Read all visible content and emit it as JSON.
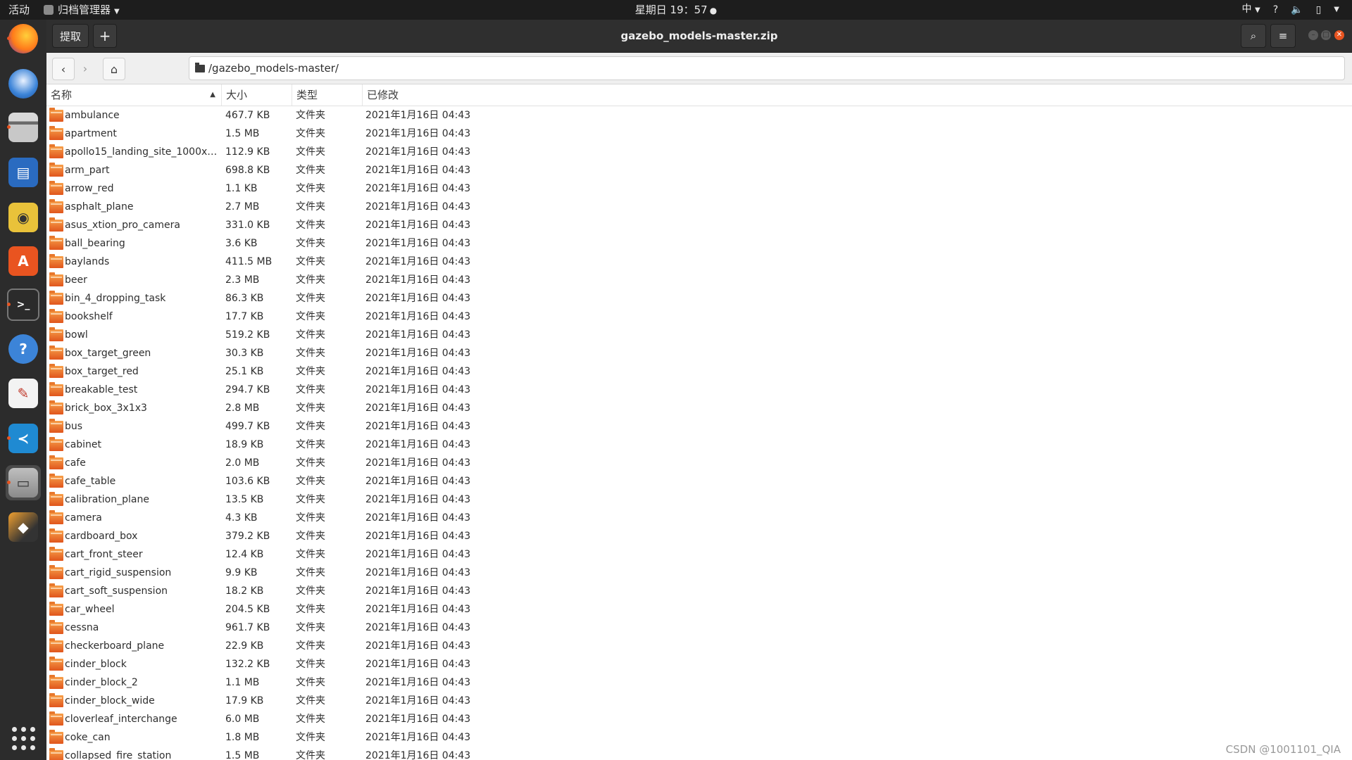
{
  "topbar": {
    "activities": "活动",
    "app_menu": "归档管理器",
    "clock": "星期日 19：57",
    "tray": {
      "input_method": "中",
      "help": "?",
      "volume_icon": "volume-icon",
      "power_icon": "battery-icon"
    }
  },
  "dock": {
    "items": [
      "firefox-icon",
      "thunderbird-icon",
      "files-icon",
      "writer-icon",
      "rhythmbox-icon",
      "software-icon",
      "terminal-icon",
      "help-icon",
      "text-editor-icon",
      "vscode-icon",
      "archive-manager-icon",
      "virtualbox-icon",
      "show-apps-icon"
    ]
  },
  "window": {
    "title": "gazebo_models-master.zip",
    "extract_label": "提取",
    "add_label": "+"
  },
  "location": {
    "path": "/gazebo_models-master/"
  },
  "columns": {
    "name": "名称",
    "size": "大小",
    "type": "类型",
    "modified": "已修改"
  },
  "files": [
    {
      "name": "ambulance",
      "size": "467.7 KB",
      "type": "文件夹",
      "modified": "2021年1月16日 04:43"
    },
    {
      "name": "apartment",
      "size": "1.5 MB",
      "type": "文件夹",
      "modified": "2021年1月16日 04:43"
    },
    {
      "name": "apollo15_landing_site_1000x1...",
      "size": "112.9 KB",
      "type": "文件夹",
      "modified": "2021年1月16日 04:43"
    },
    {
      "name": "arm_part",
      "size": "698.8 KB",
      "type": "文件夹",
      "modified": "2021年1月16日 04:43"
    },
    {
      "name": "arrow_red",
      "size": "1.1 KB",
      "type": "文件夹",
      "modified": "2021年1月16日 04:43"
    },
    {
      "name": "asphalt_plane",
      "size": "2.7 MB",
      "type": "文件夹",
      "modified": "2021年1月16日 04:43"
    },
    {
      "name": "asus_xtion_pro_camera",
      "size": "331.0 KB",
      "type": "文件夹",
      "modified": "2021年1月16日 04:43"
    },
    {
      "name": "ball_bearing",
      "size": "3.6 KB",
      "type": "文件夹",
      "modified": "2021年1月16日 04:43"
    },
    {
      "name": "baylands",
      "size": "411.5 MB",
      "type": "文件夹",
      "modified": "2021年1月16日 04:43"
    },
    {
      "name": "beer",
      "size": "2.3 MB",
      "type": "文件夹",
      "modified": "2021年1月16日 04:43"
    },
    {
      "name": "bin_4_dropping_task",
      "size": "86.3 KB",
      "type": "文件夹",
      "modified": "2021年1月16日 04:43"
    },
    {
      "name": "bookshelf",
      "size": "17.7 KB",
      "type": "文件夹",
      "modified": "2021年1月16日 04:43"
    },
    {
      "name": "bowl",
      "size": "519.2 KB",
      "type": "文件夹",
      "modified": "2021年1月16日 04:43"
    },
    {
      "name": "box_target_green",
      "size": "30.3 KB",
      "type": "文件夹",
      "modified": "2021年1月16日 04:43"
    },
    {
      "name": "box_target_red",
      "size": "25.1 KB",
      "type": "文件夹",
      "modified": "2021年1月16日 04:43"
    },
    {
      "name": "breakable_test",
      "size": "294.7 KB",
      "type": "文件夹",
      "modified": "2021年1月16日 04:43"
    },
    {
      "name": "brick_box_3x1x3",
      "size": "2.8 MB",
      "type": "文件夹",
      "modified": "2021年1月16日 04:43"
    },
    {
      "name": "bus",
      "size": "499.7 KB",
      "type": "文件夹",
      "modified": "2021年1月16日 04:43"
    },
    {
      "name": "cabinet",
      "size": "18.9 KB",
      "type": "文件夹",
      "modified": "2021年1月16日 04:43"
    },
    {
      "name": "cafe",
      "size": "2.0 MB",
      "type": "文件夹",
      "modified": "2021年1月16日 04:43"
    },
    {
      "name": "cafe_table",
      "size": "103.6 KB",
      "type": "文件夹",
      "modified": "2021年1月16日 04:43"
    },
    {
      "name": "calibration_plane",
      "size": "13.5 KB",
      "type": "文件夹",
      "modified": "2021年1月16日 04:43"
    },
    {
      "name": "camera",
      "size": "4.3 KB",
      "type": "文件夹",
      "modified": "2021年1月16日 04:43"
    },
    {
      "name": "cardboard_box",
      "size": "379.2 KB",
      "type": "文件夹",
      "modified": "2021年1月16日 04:43"
    },
    {
      "name": "cart_front_steer",
      "size": "12.4 KB",
      "type": "文件夹",
      "modified": "2021年1月16日 04:43"
    },
    {
      "name": "cart_rigid_suspension",
      "size": "9.9 KB",
      "type": "文件夹",
      "modified": "2021年1月16日 04:43"
    },
    {
      "name": "cart_soft_suspension",
      "size": "18.2 KB",
      "type": "文件夹",
      "modified": "2021年1月16日 04:43"
    },
    {
      "name": "car_wheel",
      "size": "204.5 KB",
      "type": "文件夹",
      "modified": "2021年1月16日 04:43"
    },
    {
      "name": "cessna",
      "size": "961.7 KB",
      "type": "文件夹",
      "modified": "2021年1月16日 04:43"
    },
    {
      "name": "checkerboard_plane",
      "size": "22.9 KB",
      "type": "文件夹",
      "modified": "2021年1月16日 04:43"
    },
    {
      "name": "cinder_block",
      "size": "132.2 KB",
      "type": "文件夹",
      "modified": "2021年1月16日 04:43"
    },
    {
      "name": "cinder_block_2",
      "size": "1.1 MB",
      "type": "文件夹",
      "modified": "2021年1月16日 04:43"
    },
    {
      "name": "cinder_block_wide",
      "size": "17.9 KB",
      "type": "文件夹",
      "modified": "2021年1月16日 04:43"
    },
    {
      "name": "cloverleaf_interchange",
      "size": "6.0 MB",
      "type": "文件夹",
      "modified": "2021年1月16日 04:43"
    },
    {
      "name": "coke_can",
      "size": "1.8 MB",
      "type": "文件夹",
      "modified": "2021年1月16日 04:43"
    },
    {
      "name": "collapsed_fire_station",
      "size": "1.5 MB",
      "type": "文件夹",
      "modified": "2021年1月16日 04:43"
    }
  ],
  "watermark": "CSDN @1001101_QIA"
}
